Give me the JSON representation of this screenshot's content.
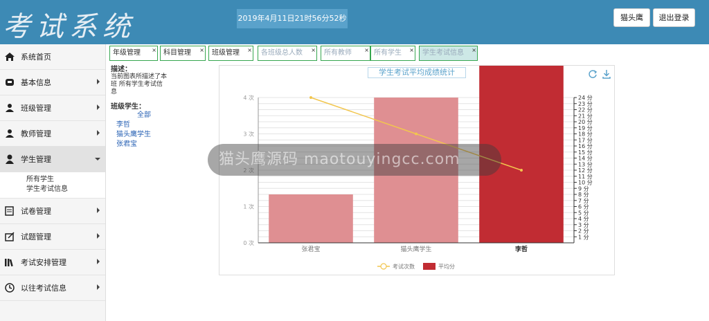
{
  "header": {
    "logo": "考试系统",
    "datetime": "2019年4月11日21时56分52秒",
    "user_button": "猫头鹰",
    "logout_button": "退出登录"
  },
  "sidebar": {
    "items": [
      {
        "label": "系统首页",
        "icon": "home-icon"
      },
      {
        "label": "基本信息",
        "icon": "info-icon"
      },
      {
        "label": "班级管理",
        "icon": "class-icon"
      },
      {
        "label": "教师管理",
        "icon": "teacher-icon"
      },
      {
        "label": "学生管理",
        "icon": "student-icon",
        "expanded": true,
        "sub": [
          "所有学生",
          "学生考试信息"
        ]
      },
      {
        "label": "试卷管理",
        "icon": "paper-icon"
      },
      {
        "label": "试题管理",
        "icon": "question-icon"
      },
      {
        "label": "考试安排管理",
        "icon": "books-icon"
      },
      {
        "label": "以往考试信息",
        "icon": "clock-icon"
      }
    ]
  },
  "tabs": [
    "年级管理",
    "科目管理",
    "班级管理",
    "各班级总人数",
    "所有教师",
    "所有学生",
    "学生考试信息"
  ],
  "info": {
    "desc_title": "描述：",
    "desc_text": "当前图表所描述了本班 所有学生考试信息",
    "students_title": "班级学生：",
    "all_link": "全部",
    "students": [
      "李哲",
      "猫头鹰学生",
      "张君宝"
    ]
  },
  "watermark": "猫头鹰源码 maotouyingcc.com",
  "colors": {
    "header": "#3d8ab5",
    "bar_light": "#df8f92",
    "bar_dark": "#c12c33",
    "line": "#f2c64e"
  },
  "chart_data": {
    "type": "bar",
    "title": "学生考试平均成绩统计",
    "categories": [
      "张君宝",
      "猫头鹰学生",
      "李哲"
    ],
    "series": [
      {
        "name": "平均分",
        "type": "bar",
        "axis": "right",
        "values": [
          8,
          24,
          40
        ]
      },
      {
        "name": "考试次数",
        "type": "line",
        "axis": "left",
        "values": [
          4,
          3,
          2
        ]
      }
    ],
    "left_axis": {
      "min": 0,
      "max": 4,
      "ticks": [
        "0 次",
        "1 次",
        "2 次",
        "3 次",
        "4 次"
      ]
    },
    "right_axis": {
      "min": 0,
      "max": 24,
      "unit": "分"
    },
    "highlighted": "李哲",
    "legend": [
      "考试次数",
      "平均分"
    ],
    "legend_position": "bottom"
  }
}
